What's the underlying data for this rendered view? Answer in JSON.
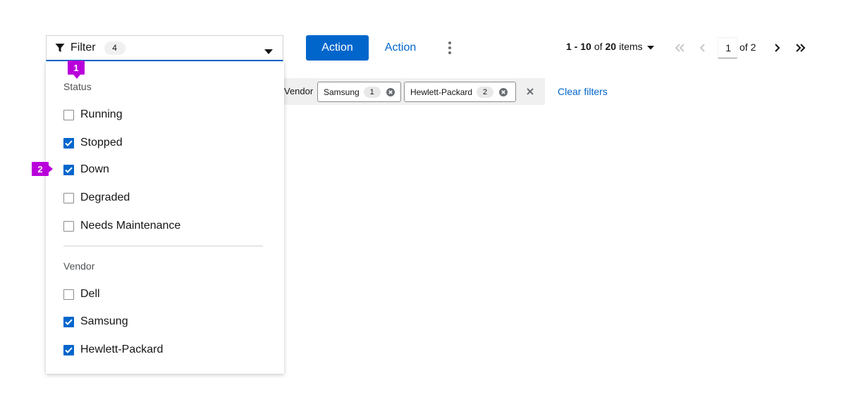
{
  "toolbar": {
    "filter_label": "Filter",
    "filter_count": "4",
    "primary_action": "Action",
    "secondary_action": "Action"
  },
  "pagination": {
    "range": "1 - 10",
    "of_word": "of",
    "total": "20",
    "items_word": "items",
    "current_page": "1",
    "of_pages": "of 2"
  },
  "chips": {
    "category": "Vendor",
    "items": [
      {
        "label": "Samsung",
        "count": "1"
      },
      {
        "label": "Hewlett-Packard",
        "count": "2"
      }
    ],
    "clear_label": "Clear filters"
  },
  "menu": {
    "groups": [
      {
        "title": "Status",
        "options": [
          {
            "label": "Running",
            "checked": false
          },
          {
            "label": "Stopped",
            "checked": true
          },
          {
            "label": "Down",
            "checked": true
          },
          {
            "label": "Degraded",
            "checked": false
          },
          {
            "label": "Needs Maintenance",
            "checked": false
          }
        ]
      },
      {
        "title": "Vendor",
        "options": [
          {
            "label": "Dell",
            "checked": false
          },
          {
            "label": "Samsung",
            "checked": true
          },
          {
            "label": "Hewlett-Packard",
            "checked": true
          }
        ]
      }
    ]
  },
  "callouts": [
    "1",
    "2"
  ],
  "colors": {
    "accent": "#0066cc",
    "callout": "#b900db",
    "chip_bar": "#f0f0f0"
  },
  "icons": {
    "filter": "filter-icon",
    "dropdown": "caret-down-icon",
    "kebab": "kebab-icon",
    "first_page": "angle-double-left-icon",
    "prev_page": "angle-left-icon",
    "next_page": "angle-right-icon",
    "last_page": "angle-double-right-icon",
    "chip_remove": "times-circle-icon",
    "close": "times-icon",
    "check": "check-icon"
  }
}
